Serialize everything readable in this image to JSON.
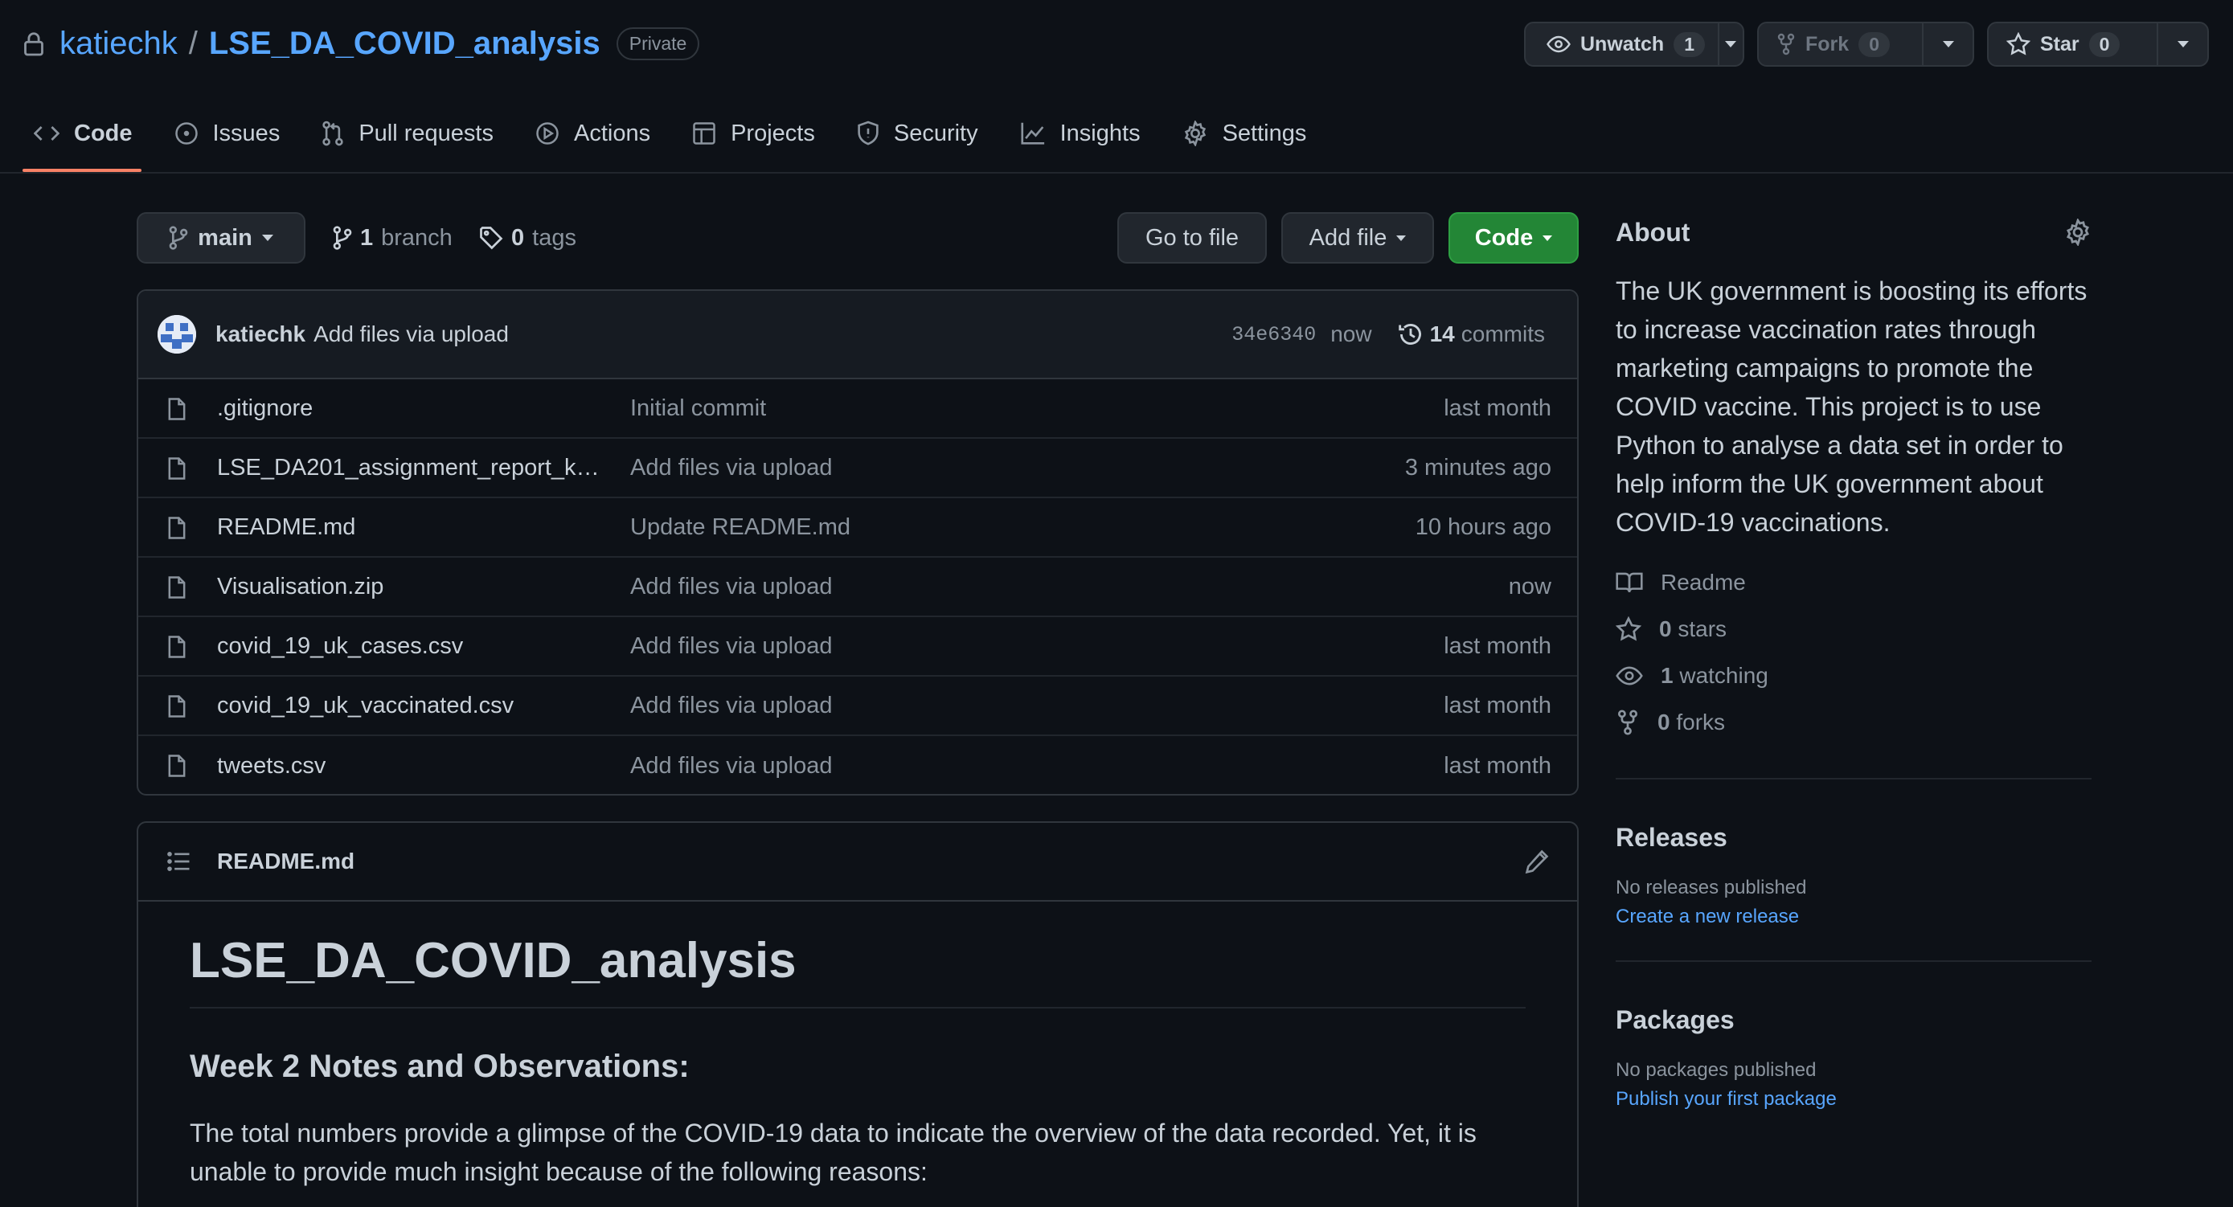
{
  "repo": {
    "owner": "katiechk",
    "separator": "/",
    "name": "LSE_DA_COVID_analysis",
    "visibility": "Private"
  },
  "header_actions": {
    "watch_label": "Unwatch",
    "watch_count": "1",
    "fork_label": "Fork",
    "fork_count": "0",
    "star_label": "Star",
    "star_count": "0"
  },
  "tabs": [
    {
      "label": "Code",
      "icon": "code-icon",
      "active": true
    },
    {
      "label": "Issues",
      "icon": "issue-icon"
    },
    {
      "label": "Pull requests",
      "icon": "pull-request-icon"
    },
    {
      "label": "Actions",
      "icon": "play-icon"
    },
    {
      "label": "Projects",
      "icon": "table-icon"
    },
    {
      "label": "Security",
      "icon": "shield-icon"
    },
    {
      "label": "Insights",
      "icon": "graph-icon"
    },
    {
      "label": "Settings",
      "icon": "gear-icon"
    }
  ],
  "toolbar": {
    "branch": "main",
    "branch_count": "1",
    "branch_word": "branch",
    "tag_count": "0",
    "tag_word": "tags",
    "go_to_file": "Go to file",
    "add_file": "Add file",
    "code": "Code"
  },
  "latest_commit": {
    "author": "katiechk",
    "message": "Add files via upload",
    "sha": "34e6340",
    "time": "now",
    "commit_count": "14",
    "commit_word": "commits"
  },
  "files": [
    {
      "name": ".gitignore",
      "message": "Initial commit",
      "age": "last month"
    },
    {
      "name": "LSE_DA201_assignment_report_ka...",
      "message": "Add files via upload",
      "age": "3 minutes ago"
    },
    {
      "name": "README.md",
      "message": "Update README.md",
      "age": "10 hours ago"
    },
    {
      "name": "Visualisation.zip",
      "message": "Add files via upload",
      "age": "now"
    },
    {
      "name": "covid_19_uk_cases.csv",
      "message": "Add files via upload",
      "age": "last month"
    },
    {
      "name": "covid_19_uk_vaccinated.csv",
      "message": "Add files via upload",
      "age": "last month"
    },
    {
      "name": "tweets.csv",
      "message": "Add files via upload",
      "age": "last month"
    }
  ],
  "readme": {
    "filename": "README.md",
    "h1": "LSE_DA_COVID_analysis",
    "h2": "Week 2 Notes and Observations:",
    "paragraph": "The total numbers provide a glimpse of the COVID-19 data to indicate the overview of the data recorded. Yet, it is unable to provide much insight because of the following reasons:"
  },
  "about": {
    "title": "About",
    "description": "The UK government is boosting its efforts to increase vaccination rates through marketing campaigns to promote the COVID vaccine. This project is to use Python to analyse a data set in order to help inform the UK government about COVID-19 vaccinations.",
    "readme": "Readme",
    "stars_count": "0",
    "stars_word": "stars",
    "watching_count": "1",
    "watching_word": "watching",
    "forks_count": "0",
    "forks_word": "forks"
  },
  "releases": {
    "title": "Releases",
    "none": "No releases published",
    "link": "Create a new release"
  },
  "packages": {
    "title": "Packages",
    "none": "No packages published",
    "link": "Publish your first package"
  },
  "colors": {
    "background": "#0d1117",
    "link": "#58a6ff",
    "accent_underline": "#f78166",
    "primary_button": "#238636"
  }
}
